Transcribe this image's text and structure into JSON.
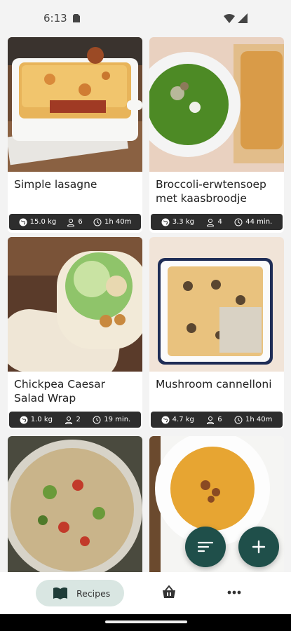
{
  "status_bar": {
    "time": "6:13"
  },
  "recipes": [
    {
      "title": "Simple lasagne",
      "co2": "15.0 kg",
      "servings": "6",
      "time": "1h 40m"
    },
    {
      "title": "Broccoli-erwtensoep met kaasbroodje",
      "co2": "3.3 kg",
      "servings": "4",
      "time": "44 min."
    },
    {
      "title": "Chickpea Caesar Salad Wrap",
      "co2": "1.0 kg",
      "servings": "2",
      "time": "19 min."
    },
    {
      "title": "Mushroom cannelloni",
      "co2": "4.7 kg",
      "servings": "6",
      "time": "1h 40m"
    }
  ],
  "bottom_nav": {
    "recipes_label": "Recipes"
  },
  "colors": {
    "accent": "#1f4f4a",
    "nav_pill": "#d9e6e2",
    "meta_bar": "#2d2d2d"
  }
}
